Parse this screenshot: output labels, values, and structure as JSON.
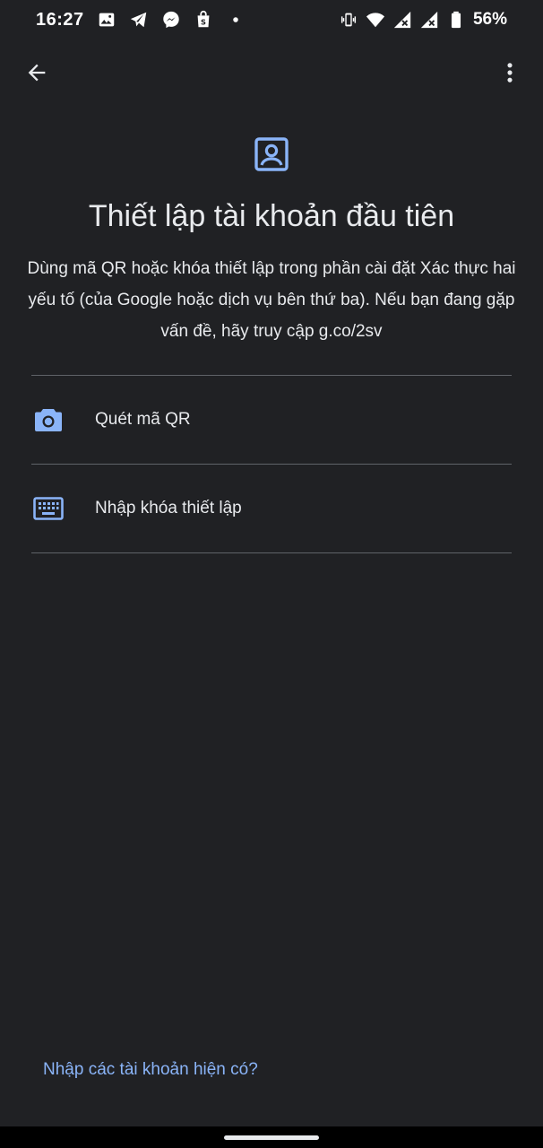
{
  "status_bar": {
    "time": "16:27",
    "battery_percent": "56%",
    "left_icons": [
      "gallery-icon",
      "telegram-icon",
      "messenger-icon",
      "shopping-bag-icon",
      "dot-icon"
    ],
    "right_icons": [
      "vibrate-icon",
      "wifi-icon",
      "signal-x-icon",
      "signal-x-icon",
      "battery-icon"
    ]
  },
  "app_bar": {
    "back_icon": "arrow-back-icon",
    "menu_icon": "more-vert-icon"
  },
  "header": {
    "icon": "account-box-icon",
    "title": "Thiết lập tài khoản đầu tiên",
    "description": "Dùng mã QR hoặc khóa thiết lập trong phần cài đặt Xác thực hai yếu tố (của Google hoặc dịch vụ bên thứ ba). Nếu bạn đang gặp vấn đề, hãy truy cập g.co/2sv"
  },
  "options": [
    {
      "icon": "camera-icon",
      "label": "Quét mã QR"
    },
    {
      "icon": "keyboard-icon",
      "label": "Nhập khóa thiết lập"
    }
  ],
  "bottom_link": "Nhập các tài khoản hiện có?",
  "colors": {
    "background": "#202124",
    "text": "#e8eaed",
    "accent": "#8ab4f8",
    "divider": "#5f6368"
  }
}
